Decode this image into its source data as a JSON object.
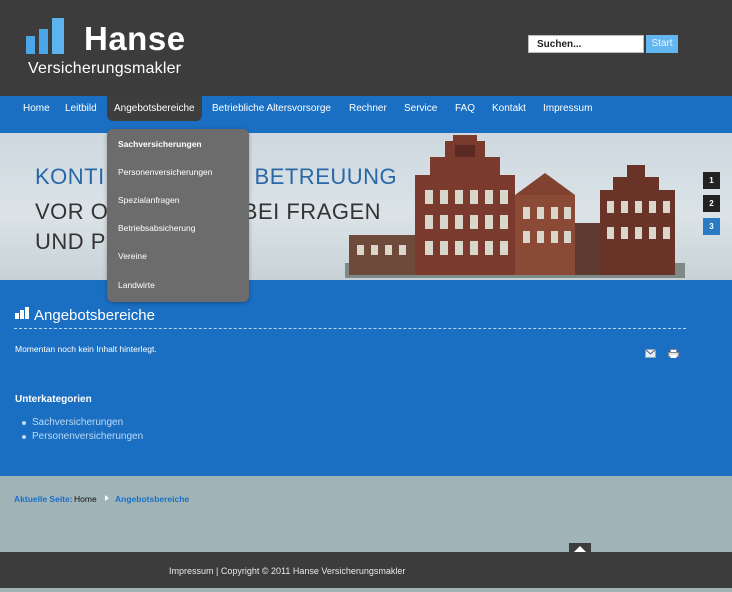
{
  "header": {
    "logo_word": "Hanse",
    "logo_sub": "Versicherungsmakler",
    "search_value": "Suchen...",
    "search_button": "Start"
  },
  "nav": {
    "items": [
      "Home",
      "Leitbild",
      "Angebotsbereiche",
      "Betriebliche Altersvorsorge",
      "Rechner",
      "Service",
      "FAQ",
      "Kontakt",
      "Impressum"
    ],
    "active": "Angebotsbereiche"
  },
  "dropdown": {
    "items": [
      "Sachversicherungen",
      "Personenversicherungen",
      "Spezialanfragen",
      "Betriebsabsicherung",
      "Vereine",
      "Landwirte"
    ]
  },
  "banner": {
    "line1": "KONTI",
    "line1b": "E BETREUUNG",
    "line2": "VOR OR",
    "line2b": "BEI FRAGEN",
    "line3": "UND PR",
    "slides": [
      "1",
      "2",
      "3"
    ],
    "active_slide": "3"
  },
  "main": {
    "title": "Angebotsbereiche",
    "no_content": "Momentan noch kein Inhalt hinterlegt.",
    "sub_heading": "Unterkategorien",
    "sub_links": [
      "Sachversicherungen",
      "Personenversicherungen"
    ],
    "icons": [
      "email-icon",
      "print-icon"
    ]
  },
  "breadcrumb": {
    "label": "Aktuelle Seite:",
    "home": "Home",
    "current": "Angebotsbereiche"
  },
  "footer": {
    "text": "Impressum | Copyright © 2011 Hanse Versicherungsmakler"
  },
  "colors": {
    "header_bg": "#3c3c3c",
    "brand_blue": "#1a6fc3",
    "accent_light_blue": "#4aa6e8",
    "dropdown_bg": "#6c6c6c"
  }
}
